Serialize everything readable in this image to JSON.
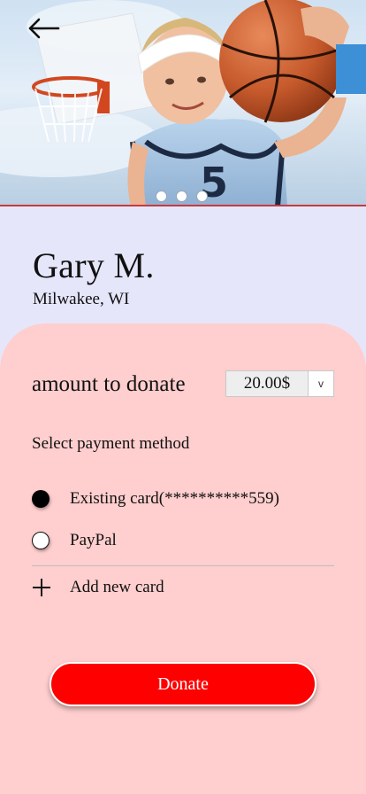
{
  "hero": {
    "image_subject": "child with basketball",
    "jersey_number": "5",
    "back_icon": "arrow-left-icon",
    "carousel_dots": 3
  },
  "profile": {
    "name": "Gary M.",
    "location": "Milwakee, WI"
  },
  "donation": {
    "amount_label": "amount to donate",
    "amount_value": "20.00$",
    "dropdown_caret": "v"
  },
  "payment": {
    "section_label": "Select payment method",
    "options": [
      {
        "label": "Existing card(**********559)",
        "selected": true
      },
      {
        "label": "PayPal",
        "selected": false
      }
    ],
    "add_new_label": "Add new card"
  },
  "actions": {
    "donate_label": "Donate"
  },
  "colors": {
    "page_background": "#e6e6fb",
    "panel_background": "#ffcece",
    "donate_button": "#ff0000",
    "hero_divider": "#c8393e"
  }
}
